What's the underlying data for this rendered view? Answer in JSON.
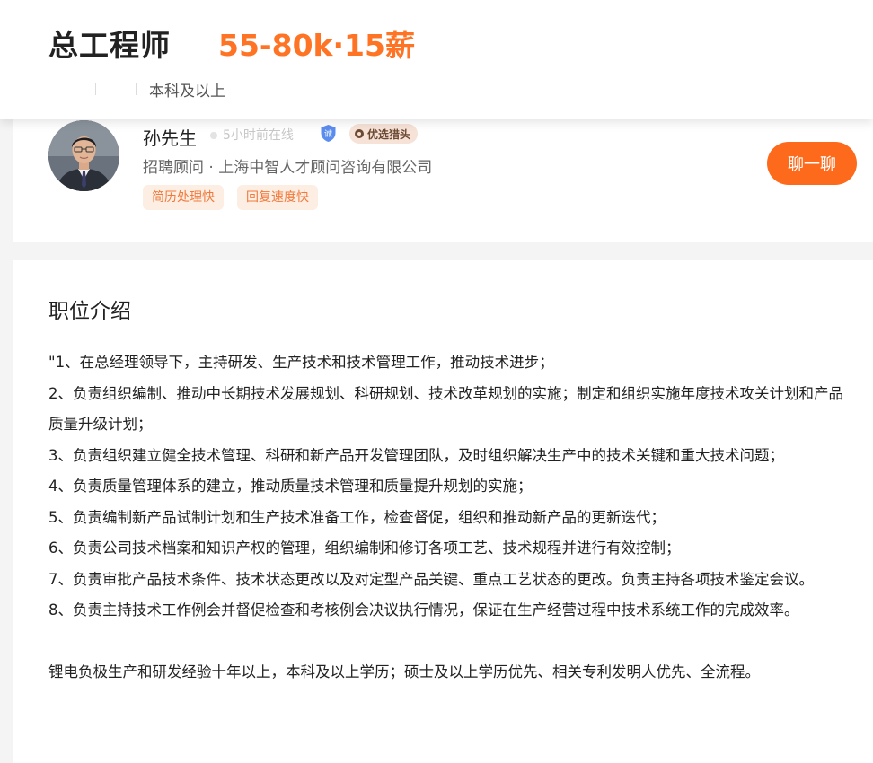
{
  "header": {
    "title": "总工程师",
    "salary": "55-80k·15薪",
    "requirements": [
      "本科及以上"
    ]
  },
  "recruiter": {
    "name": "孙先生",
    "online_status": "5小时前在线",
    "verify_badge_icon": "诚",
    "badge_label": "优选猎头",
    "role_company": "招聘顾问 · 上海中智人才顾问咨询有限公司",
    "tags": [
      "简历处理快",
      "回复速度快"
    ],
    "chat_button": "聊一聊"
  },
  "description": {
    "heading": "职位介绍",
    "lines": [
      "\"1、在总经理领导下，主持研发、生产技术和技术管理工作，推动技术进步；",
      "2、负责组织编制、推动中长期技术发展规划、科研规划、技术改革规划的实施；制定和组织实施年度技术攻关计划和产品质量升级计划；",
      "3、负责组织建立健全技术管理、科研和新产品开发管理团队，及时组织解决生产中的技术关键和重大技术问题；",
      "4、负责质量管理体系的建立，推动质量技术管理和质量提升规划的实施；",
      "5、负责编制新产品试制计划和生产技术准备工作，检查督促，组织和推动新产品的更新迭代；",
      "6、负责公司技术档案和知识产权的管理，组织编制和修订各项工艺、技术规程并进行有效控制；",
      "7、负责审批产品技术条件、技术状态更改以及对定型产品关键、重点工艺状态的更改。负责主持各项技术鉴定会议。",
      "8、负责主持技术工作例会并督促检查和考核例会决议执行情况，保证在生产经营过程中技术系统工作的完成效率。"
    ],
    "requirement": "锂电负极生产和研发经验十年以上，本科及以上学历；硕士及以上学历优先、相关专利发明人优先、全流程。"
  },
  "colors": {
    "accent": "#fe7424",
    "button": "#fe6a1b",
    "tag_bg": "#fdeee4",
    "tag_text": "#f07a3c"
  }
}
